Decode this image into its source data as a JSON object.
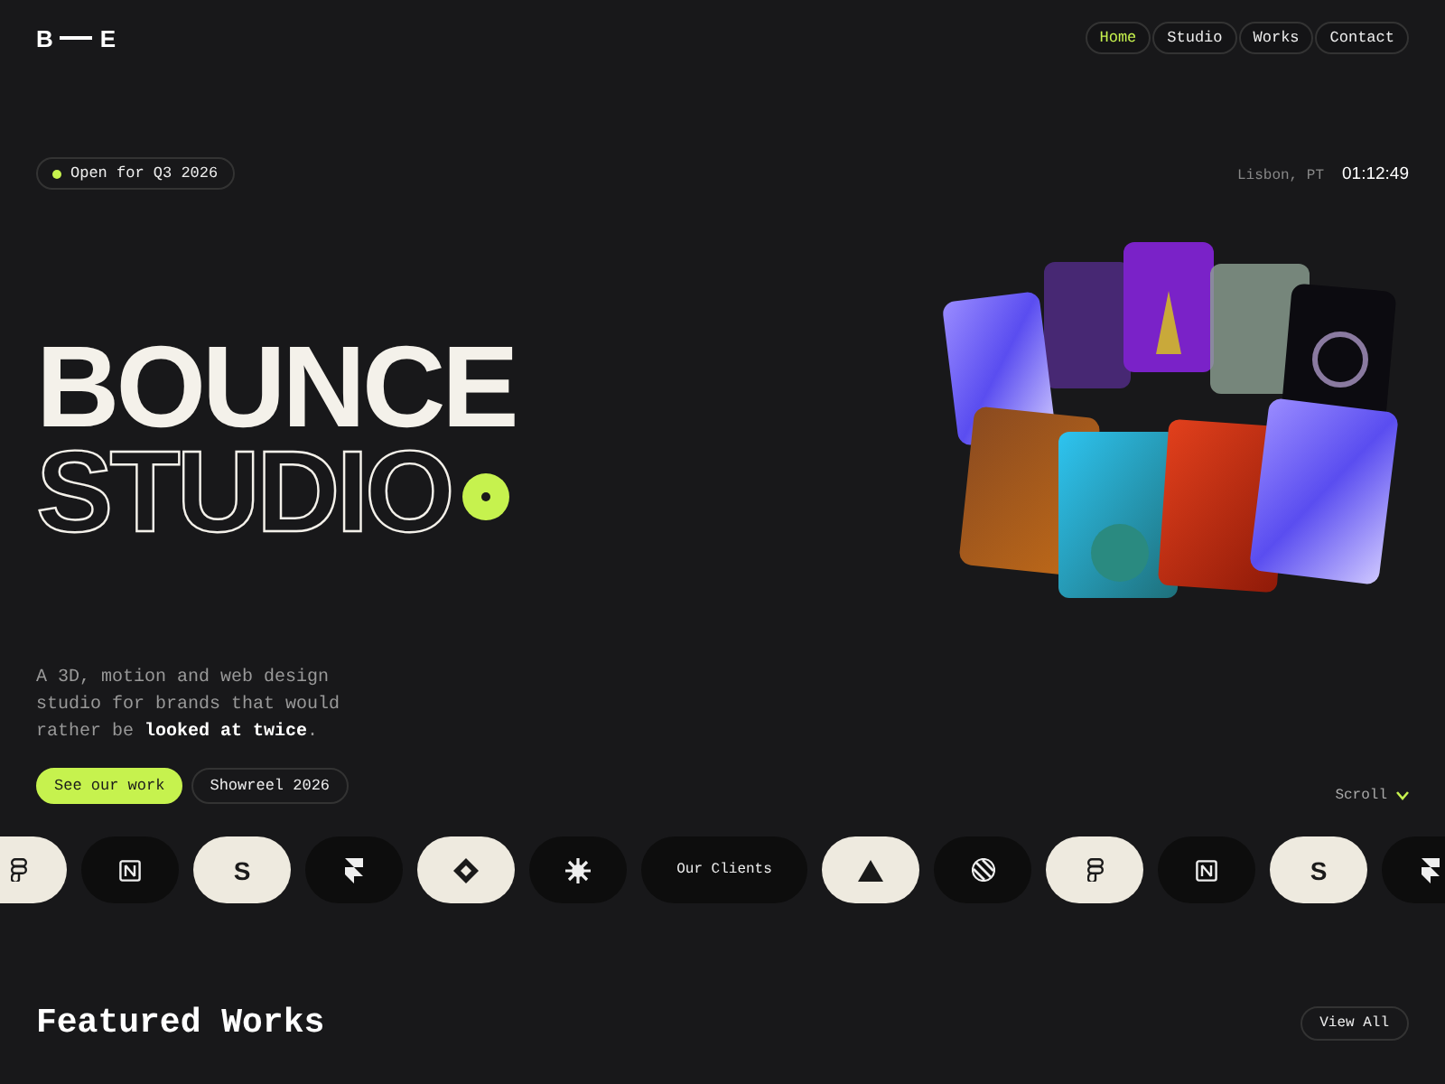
{
  "logo": {
    "left": "B",
    "right": "E"
  },
  "nav": [
    {
      "label": "Home",
      "selected": true
    },
    {
      "label": "Studio",
      "selected": false
    },
    {
      "label": "Works",
      "selected": false
    },
    {
      "label": "Contact",
      "selected": false
    }
  ],
  "availability": "Open for Q3 2026",
  "location": "Lisbon, PT",
  "time": "01:12:49",
  "hero": {
    "title_solid": "BOUNCE",
    "title_outline": "STUDIO"
  },
  "description": "A 3D, motion and web design studio for brands that would rather be **looked at twice**.",
  "buttons": [
    {
      "label": "See our work",
      "kind": "primary"
    },
    {
      "label": "Showreel 2026",
      "kind": "outline"
    }
  ],
  "scroll": "Scroll",
  "clients": [
    {
      "kind": "blocks",
      "color": "#eeeadf"
    },
    {
      "kind": "cube",
      "color": "#0d0d0d"
    },
    {
      "kind": "letter",
      "color": "#eeeadf",
      "text": "S"
    },
    {
      "kind": "bolt",
      "color": "#0d0d0d"
    },
    {
      "kind": "diamond",
      "color": "#eeeadf"
    },
    {
      "kind": "burst",
      "color": "#0d0d0d"
    },
    {
      "kind": "label",
      "color": "#0d0d0d",
      "text": "Our Clients"
    },
    {
      "kind": "triangle",
      "color": "#eeeadf"
    },
    {
      "kind": "disc",
      "color": "#0d0d0d"
    },
    {
      "kind": "blocks",
      "color": "#eeeadf"
    },
    {
      "kind": "cube",
      "color": "#0d0d0d"
    },
    {
      "kind": "letter",
      "color": "#eeeadf",
      "text": "S"
    },
    {
      "kind": "bolt",
      "color": "#0d0d0d"
    }
  ],
  "featured": {
    "title": "Featured Works",
    "action": "View All"
  }
}
